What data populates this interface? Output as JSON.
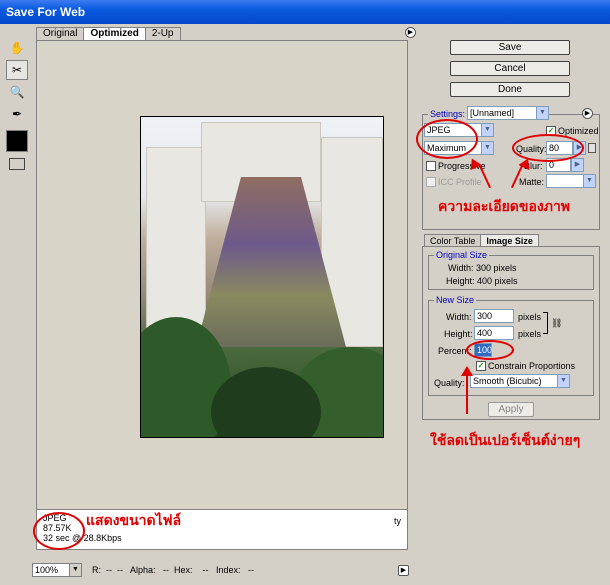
{
  "window": {
    "title": "Save For Web"
  },
  "preview_tabs": [
    {
      "label": "Original"
    },
    {
      "label": "Optimized"
    },
    {
      "label": "2-Up"
    }
  ],
  "buttons": {
    "save": "Save",
    "cancel": "Cancel",
    "done": "Done",
    "apply": "Apply"
  },
  "settings": {
    "label": "Settings:",
    "preset": "[Unnamed]",
    "format": "JPEG",
    "compression": "Maximum",
    "optimized_label": "Optimized",
    "optimized_checked": true,
    "quality_label": "Quality:",
    "quality_value": "80",
    "progressive_label": "Progressive",
    "blur_label": "Blur:",
    "blur_value": "0",
    "icc_label": "ICC Profile",
    "matte_label": "Matte:"
  },
  "panel_tabs": [
    {
      "label": "Color Table"
    },
    {
      "label": "Image Size"
    }
  ],
  "image_size": {
    "original_legend": "Original Size",
    "orig_width": "Width: 300 pixels",
    "orig_height": "Height: 400 pixels",
    "new_legend": "New Size",
    "width_label": "Width:",
    "width_value": "300",
    "width_unit": "pixels",
    "height_label": "Height:",
    "height_value": "400",
    "height_unit": "pixels",
    "percent_label": "Percent:",
    "percent_value": "100",
    "constrain_label": "Constrain Proportions",
    "constrain_checked": true,
    "quality_label": "Quality:",
    "quality_value": "Smooth (Bicubic)"
  },
  "preview_info": {
    "format": "JPEG",
    "size": "87.57K",
    "time": "32 sec @ 28.8Kbps",
    "right_text": "ty"
  },
  "statusbar": {
    "zoom": "100%",
    "readout": "R:  --  --   Alpha:   --  Hex:    --   Index:   --"
  },
  "annotations": {
    "detail": "ความละเอียดของภาพ",
    "percent_tip": "ใช้ลดเป็นเปอร์เซ็นต์ง่ายๆ",
    "filesize": "แสดงขนาดไฟล์"
  },
  "colors": {
    "titlebar": "#0a5ae0",
    "annotation": "#e00000"
  }
}
